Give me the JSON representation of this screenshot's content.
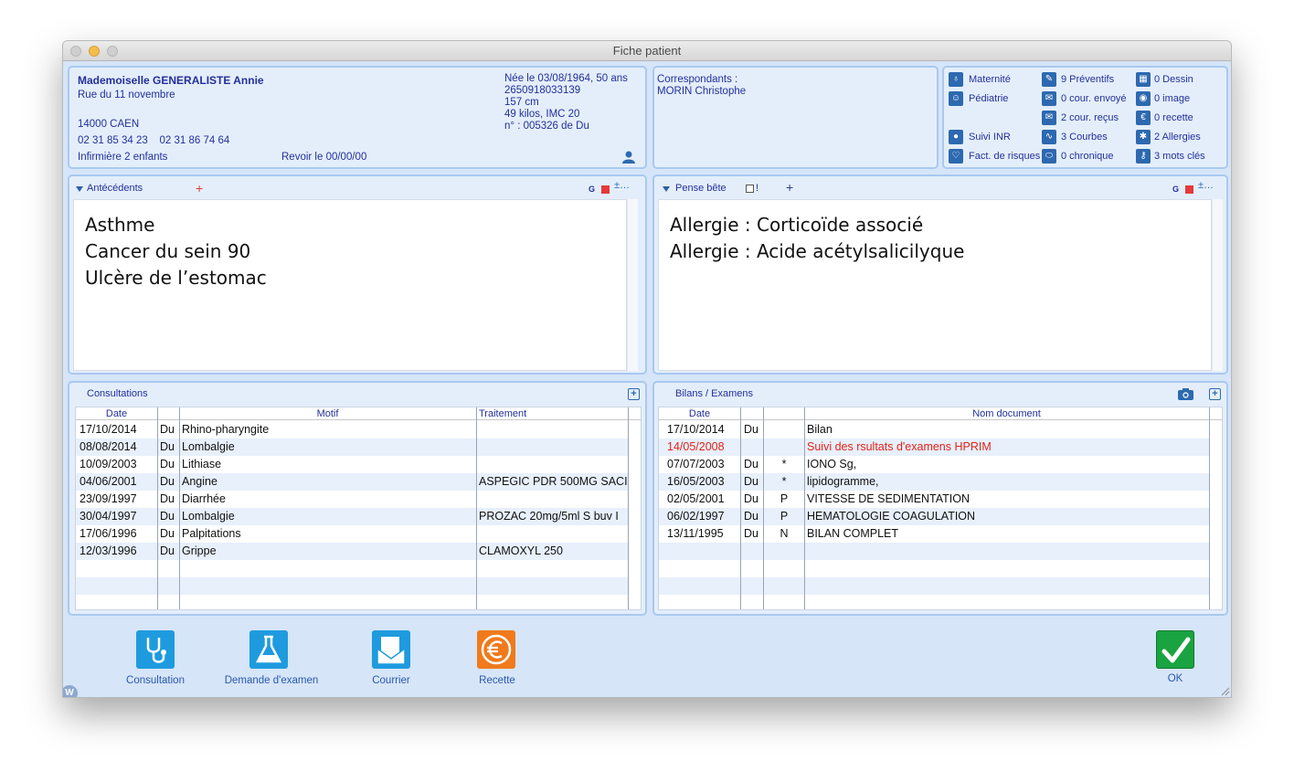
{
  "window": {
    "title": "Fiche patient"
  },
  "patient": {
    "name": "Mademoiselle GENERALISTE Annie",
    "street": "Rue du 11 novembre",
    "city": "14000 CAEN",
    "phones": "02 31 85 34 23    02 31 86 74 64",
    "note": "Infirmière 2 enfants",
    "revoir": "Revoir le 00/00/00",
    "born": "Née le 03/08/1964, 50 ans",
    "ss_number": "2650918033139",
    "height": "157 cm",
    "weight": "49 kilos, IMC 20",
    "file_number": "n° : 005326 de Du"
  },
  "correspondants": {
    "label": "Correspondants :",
    "name": "MORIN Christophe"
  },
  "stats": {
    "col1": [
      "Maternité",
      "Pédiatrie",
      "",
      "Suivi INR",
      "Fact. de risques"
    ],
    "col2": [
      "9 Préventifs",
      "0 cour. envoyé",
      "2 cour. reçus",
      "3 Courbes",
      "0 chronique"
    ],
    "col3": [
      "0 Dessin",
      "0 image",
      "0 recette",
      "2 Allergies",
      "3 mots clés"
    ]
  },
  "antecedents": {
    "title": "Antécédents",
    "plus": "+",
    "g": "G",
    "lines": [
      "Asthme",
      "Cancer du sein 90",
      "Ulcère de l’estomac"
    ]
  },
  "pense_bete": {
    "title": "Pense bête",
    "flag": "!",
    "plus": "+",
    "g": "G",
    "lines": [
      "Allergie : Corticoïde associé",
      "Allergie : Acide acétylsalicilyque"
    ]
  },
  "consultations": {
    "title": "Consultations",
    "headers": [
      "Date",
      "Motif",
      "Traitement"
    ],
    "rows": [
      [
        "17/10/2014",
        "Du",
        "Rhino-pharyngite",
        ""
      ],
      [
        "08/08/2014",
        "Du",
        "Lombalgie",
        ""
      ],
      [
        "10/09/2003",
        "Du",
        "Lithiase",
        ""
      ],
      [
        "04/06/2001",
        "Du",
        "Angine",
        "ASPEGIC PDR 500MG SACI"
      ],
      [
        "23/09/1997",
        "Du",
        "Diarrhée",
        ""
      ],
      [
        "30/04/1997",
        "Du",
        "Lombalgie",
        "PROZAC 20mg/5ml S buv I"
      ],
      [
        "17/06/1996",
        "Du",
        "Palpitations",
        ""
      ],
      [
        "12/03/1996",
        "Du",
        "Grippe",
        "CLAMOXYL 250"
      ]
    ]
  },
  "bilans": {
    "title": "Bilans / Examens",
    "headers": [
      "Date",
      "Nom document"
    ],
    "highlight_color": "#e2231a",
    "rows": [
      [
        "17/10/2014",
        "Du",
        "",
        "Bilan"
      ],
      [
        "14/05/2008",
        "",
        "",
        "Suivi des rsultats d'examens HPRIM"
      ],
      [
        "07/07/2003",
        "Du",
        "*",
        " IONO Sg,"
      ],
      [
        "16/05/2003",
        "Du",
        "*",
        "lipidogramme,"
      ],
      [
        "02/05/2001",
        "Du",
        "P",
        "VITESSE DE SEDIMENTATION"
      ],
      [
        "06/02/1997",
        "Du",
        "P",
        "HEMATOLOGIE  COAGULATION"
      ],
      [
        "13/11/1995",
        "Du",
        "N",
        "BILAN COMPLET"
      ]
    ]
  },
  "actions": {
    "consultation": "Consultation",
    "demande": "Demande d'examen",
    "courrier": "Courrier",
    "recette": "Recette",
    "ok": "OK"
  },
  "corner_badge": "W",
  "colors": {
    "accent": "#2d69b0",
    "ok_green": "#1aa341",
    "recette_orange": "#f07a1c",
    "panel_border": "#a9c9ef"
  }
}
